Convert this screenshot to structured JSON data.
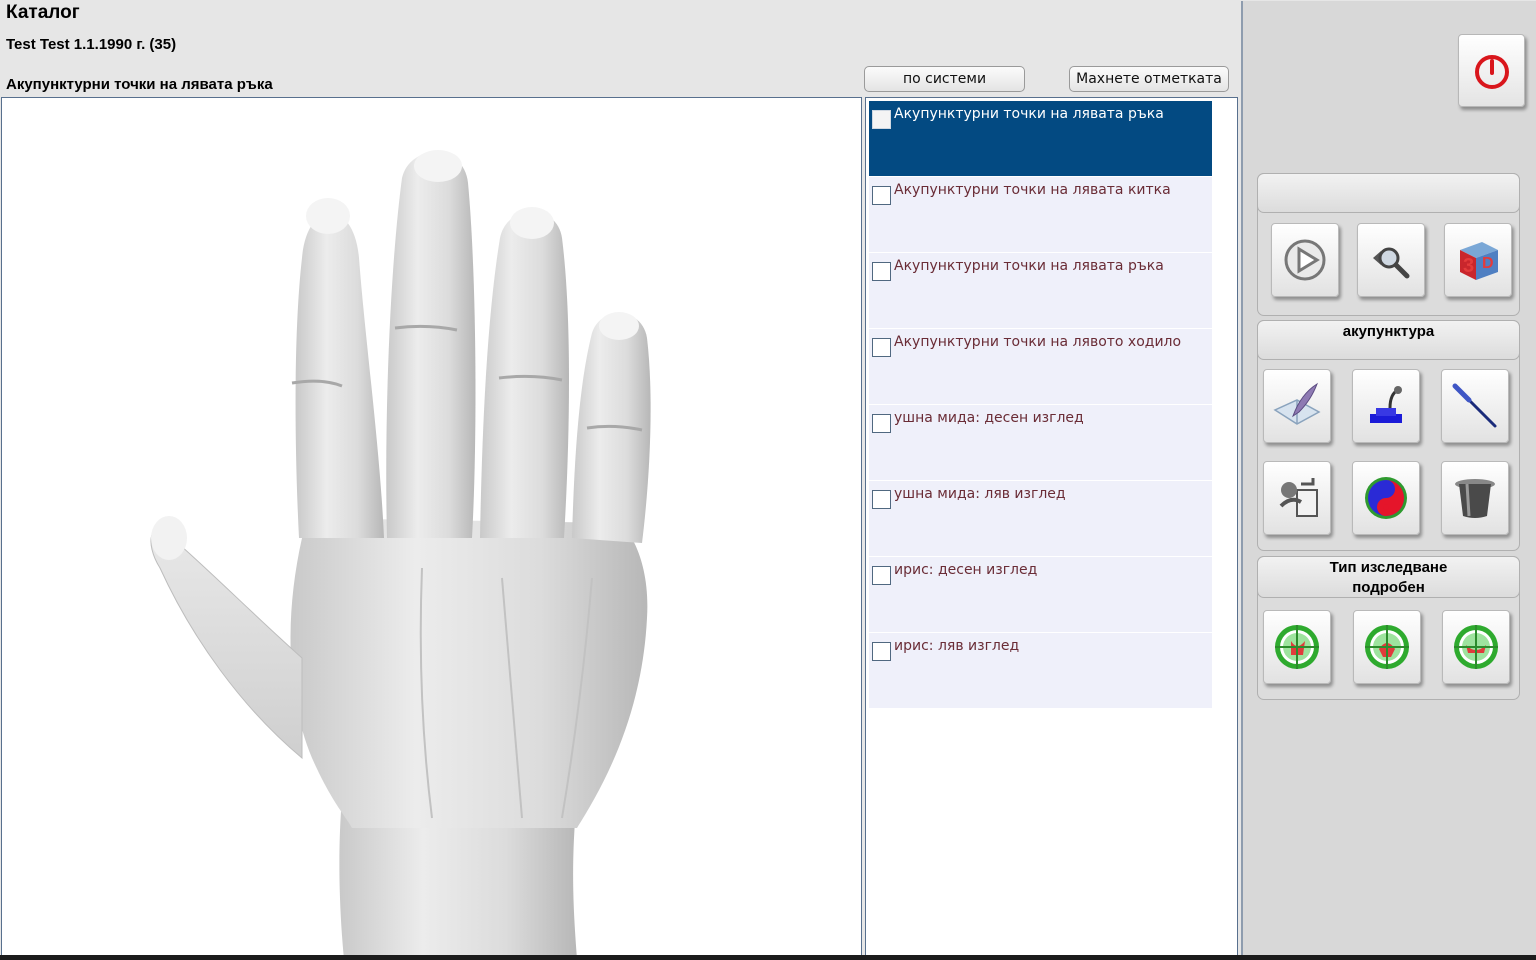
{
  "header": {
    "title": "Каталог",
    "patient": "Test  Test    1.1.1990 г. (35)",
    "section_title": "Акупунктурни точки на лявата ръка"
  },
  "toolbar": {
    "systems_button": "по системи",
    "uncheck_button": "Махнете отметката"
  },
  "catalog_items": [
    {
      "label": "Акупунктурни точки на лявата ръка",
      "selected": true
    },
    {
      "label": "Акупунктурни точки на лявата китка",
      "selected": false
    },
    {
      "label": "Акупунктурни точки на лявата ръка",
      "selected": false
    },
    {
      "label": "Акупунктурни точки на лявото ходило",
      "selected": false
    },
    {
      "label": "ушна мида: десен изглед",
      "selected": false
    },
    {
      "label": "ушна мида: ляв изглед",
      "selected": false
    },
    {
      "label": "ирис: десен изглед",
      "selected": false
    },
    {
      "label": "ирис: ляв изглед",
      "selected": false
    }
  ],
  "right_panel": {
    "acupuncture_label": "акупунктура",
    "exam_type_label_line1": "Тип изследване",
    "exam_type_label_line2": "подробен",
    "icons": {
      "power": "power-icon",
      "view_tools": [
        "play-icon",
        "zoom-icon",
        "3d-icon"
      ],
      "acupuncture_tools": [
        "book-quill-icon",
        "stamp-icon",
        "needle-icon",
        "transfer-icon",
        "yin-yang-icon",
        "moxa-cup-icon"
      ],
      "exam_tools": [
        "target-icon",
        "target-icon",
        "target-icon"
      ]
    }
  },
  "colors": {
    "selected_row": "#034a82",
    "row_text": "#6a2c36",
    "power_red": "#d9161c"
  }
}
